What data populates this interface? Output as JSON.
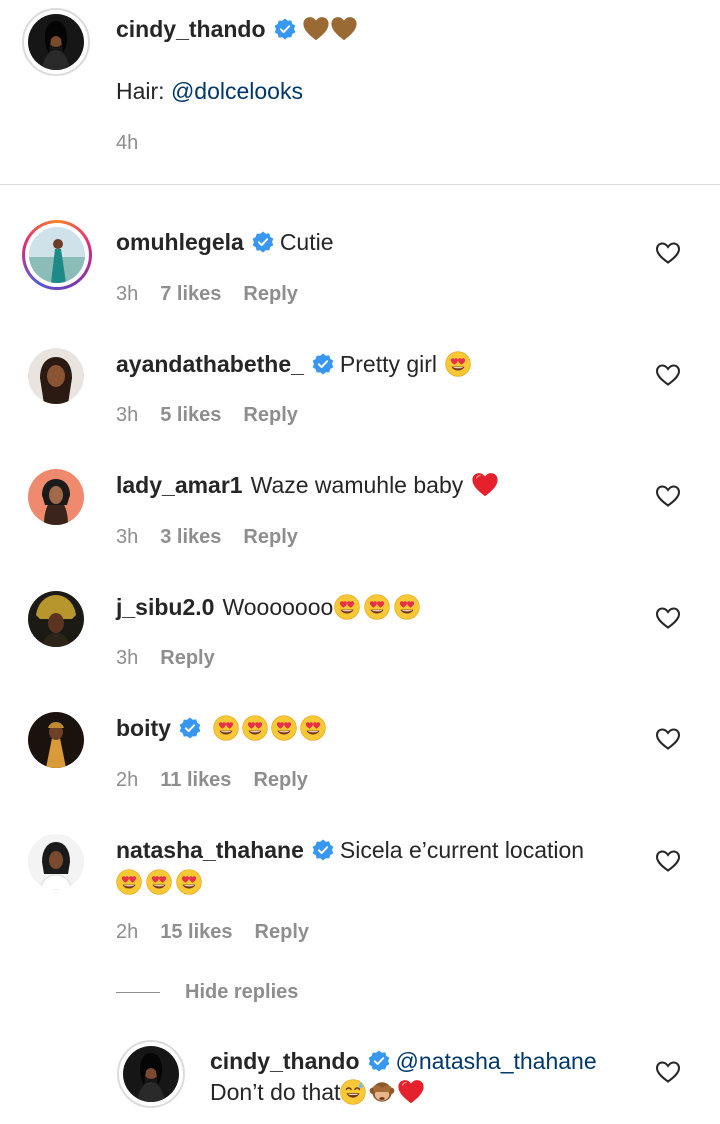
{
  "caption": {
    "username": "cindy_thando",
    "line2_prefix": "Hair: ",
    "line2_mention": "@dolcelooks",
    "time": "4h"
  },
  "comments": [
    {
      "username": "omuhlegela",
      "text": "Cutie",
      "time": "3h",
      "likes": "7 likes",
      "reply": "Reply"
    },
    {
      "username": "ayandathabethe_",
      "text": "Pretty girl",
      "time": "3h",
      "likes": "5 likes",
      "reply": "Reply"
    },
    {
      "username": "lady_amar1",
      "text": "Waze wamuhle baby",
      "time": "3h",
      "likes": "3 likes",
      "reply": "Reply"
    },
    {
      "username": "j_sibu2.0",
      "text": "Wooooooo",
      "time": "3h",
      "reply": "Reply"
    },
    {
      "username": "boity",
      "time": "2h",
      "likes": "11 likes",
      "reply": "Reply"
    },
    {
      "username": "natasha_thahane",
      "text": "Sicela e’current location",
      "time": "2h",
      "likes": "15 likes",
      "reply": "Reply"
    }
  ],
  "hide_replies": "Hide replies",
  "reply_comment": {
    "username": "cindy_thando",
    "mention": "@natasha_thahane",
    "text": "Don’t do that"
  },
  "colors": {
    "verified": "#3897f0",
    "mention": "#00376b",
    "secondary_text": "#8e8e8e",
    "heart_red": "#ed1c24"
  },
  "icons": [
    "verified-badge-icon",
    "brown-heart-icon",
    "heart-eyes-emoji-icon",
    "red-heart-icon",
    "sweat-smile-emoji-icon",
    "see-no-evil-monkey-emoji-icon",
    "like-heart-outline-icon"
  ]
}
